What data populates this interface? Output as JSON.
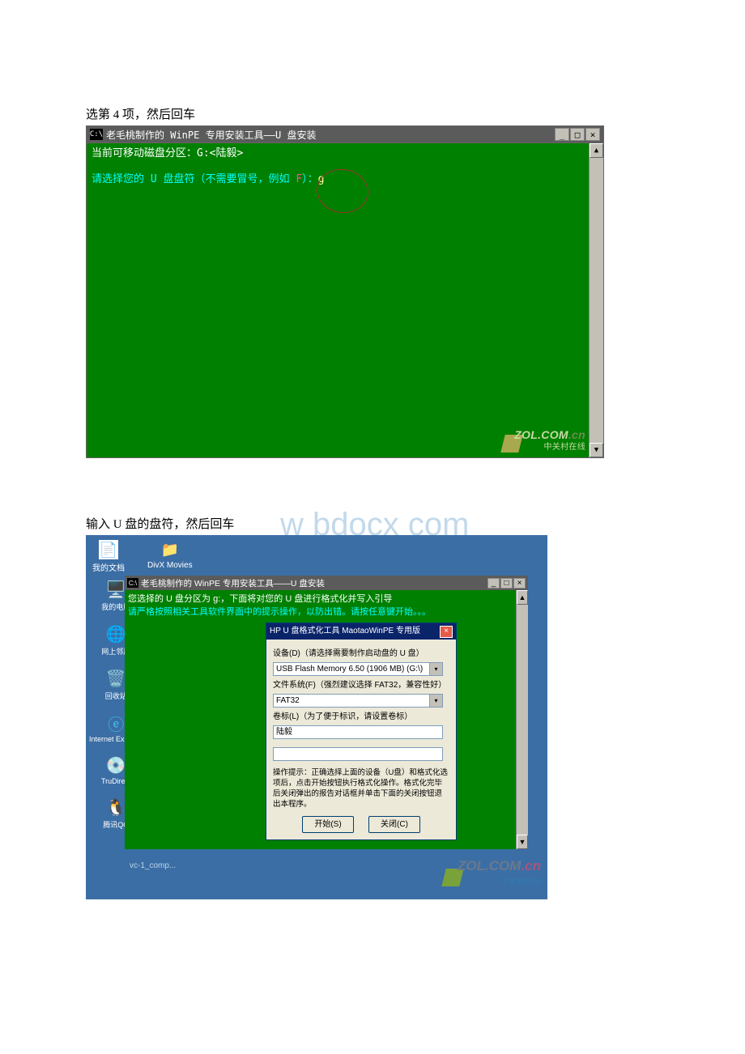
{
  "caption1": "选第 4 项，然后回车",
  "shot1": {
    "title": "老毛桃制作的 WinPE 专用安装工具——U 盘安装",
    "icon_text": "C:\\",
    "line1": "当前可移动磁盘分区：G:<陆毅>",
    "line2_pre": "请选择您的 U 盘盘符（不需要冒号，例如 ",
    "line2_pink": "F",
    "line2_mid": "）：",
    "line2_yel": "g",
    "zol": "ZOL.COM",
    "zol_cn": ".cn",
    "zol_sub": "中关村在线"
  },
  "caption2": "输入 U 盘的盘符，然后回车",
  "watermark": "w bdocx com",
  "shot2": {
    "desk": {
      "mydocs": "我的文档",
      "divx": "DivX Movies",
      "mycomp": "我的电脑",
      "netn": "网上邻居",
      "recycle": "回收站",
      "ie": "Internet Explorer",
      "tru": "TruDirect",
      "qq": "腾讯QQ"
    },
    "win": {
      "title": "老毛桃制作的 WinPE 专用安装工具——U 盘安装",
      "l1": "您选择的 U 盘分区为 g:，下面将对您的 U 盘进行格式化并写入引导",
      "l2": "请严格按照相关工具软件界面中的提示操作，以防出错。请按任意键开始。。。"
    },
    "dialog": {
      "title": "HP U 盘格式化工具 MaotaoWinPE 专用版",
      "lbl_device": "设备(D)（请选择需要制作启动盘的 U 盘）",
      "combo_device": "USB Flash Memory 6.50 (1906 MB) (G:\\)",
      "lbl_fs": "文件系统(F)（强烈建议选择 FAT32，兼容性好）",
      "combo_fs": "FAT32",
      "lbl_label": "卷标(L)（为了便于标识，请设置卷标）",
      "inp_label": "陆毅",
      "tip": "操作提示：正确选择上面的设备（U盘）和格式化选项后，点击开始按钮执行格式化操作。格式化完毕后关闭弹出的报告对话框并单击下面的关闭按钮退出本程序。",
      "btn_start": "开始(S)",
      "btn_close": "关闭(C)"
    },
    "taskbar_item": "vc-1_comp...",
    "zol": "ZOL.COM",
    "zol_cn": ".cn",
    "zol_sub": "中关村在线"
  }
}
